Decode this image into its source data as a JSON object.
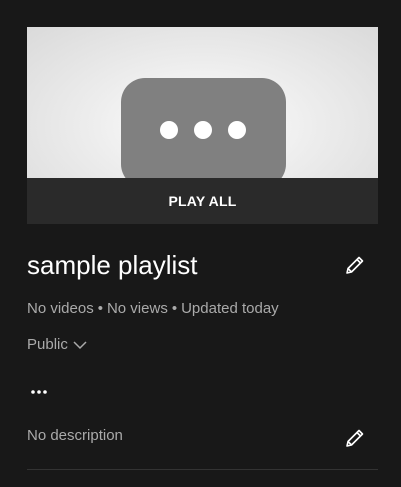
{
  "playlist": {
    "thumbnail_icon": "more-horizontal-placeholder-icon",
    "play_all_label": "PLAY ALL",
    "title": "sample playlist",
    "stats": {
      "videos": "No videos",
      "views": "No views",
      "updated": "Updated today",
      "separator": "•"
    },
    "privacy": {
      "value": "Public",
      "icon": "chevron-down-icon"
    },
    "more_icon": "more-horizontal-icon",
    "description": "No description",
    "edit_icon": "pencil-icon"
  },
  "colors": {
    "background": "#181818",
    "play_all_bar": "#2a2a2a",
    "primary_text": "#ffffff",
    "secondary_text": "#aaaaaa",
    "divider": "#333333",
    "placeholder_shape": "#808080"
  }
}
